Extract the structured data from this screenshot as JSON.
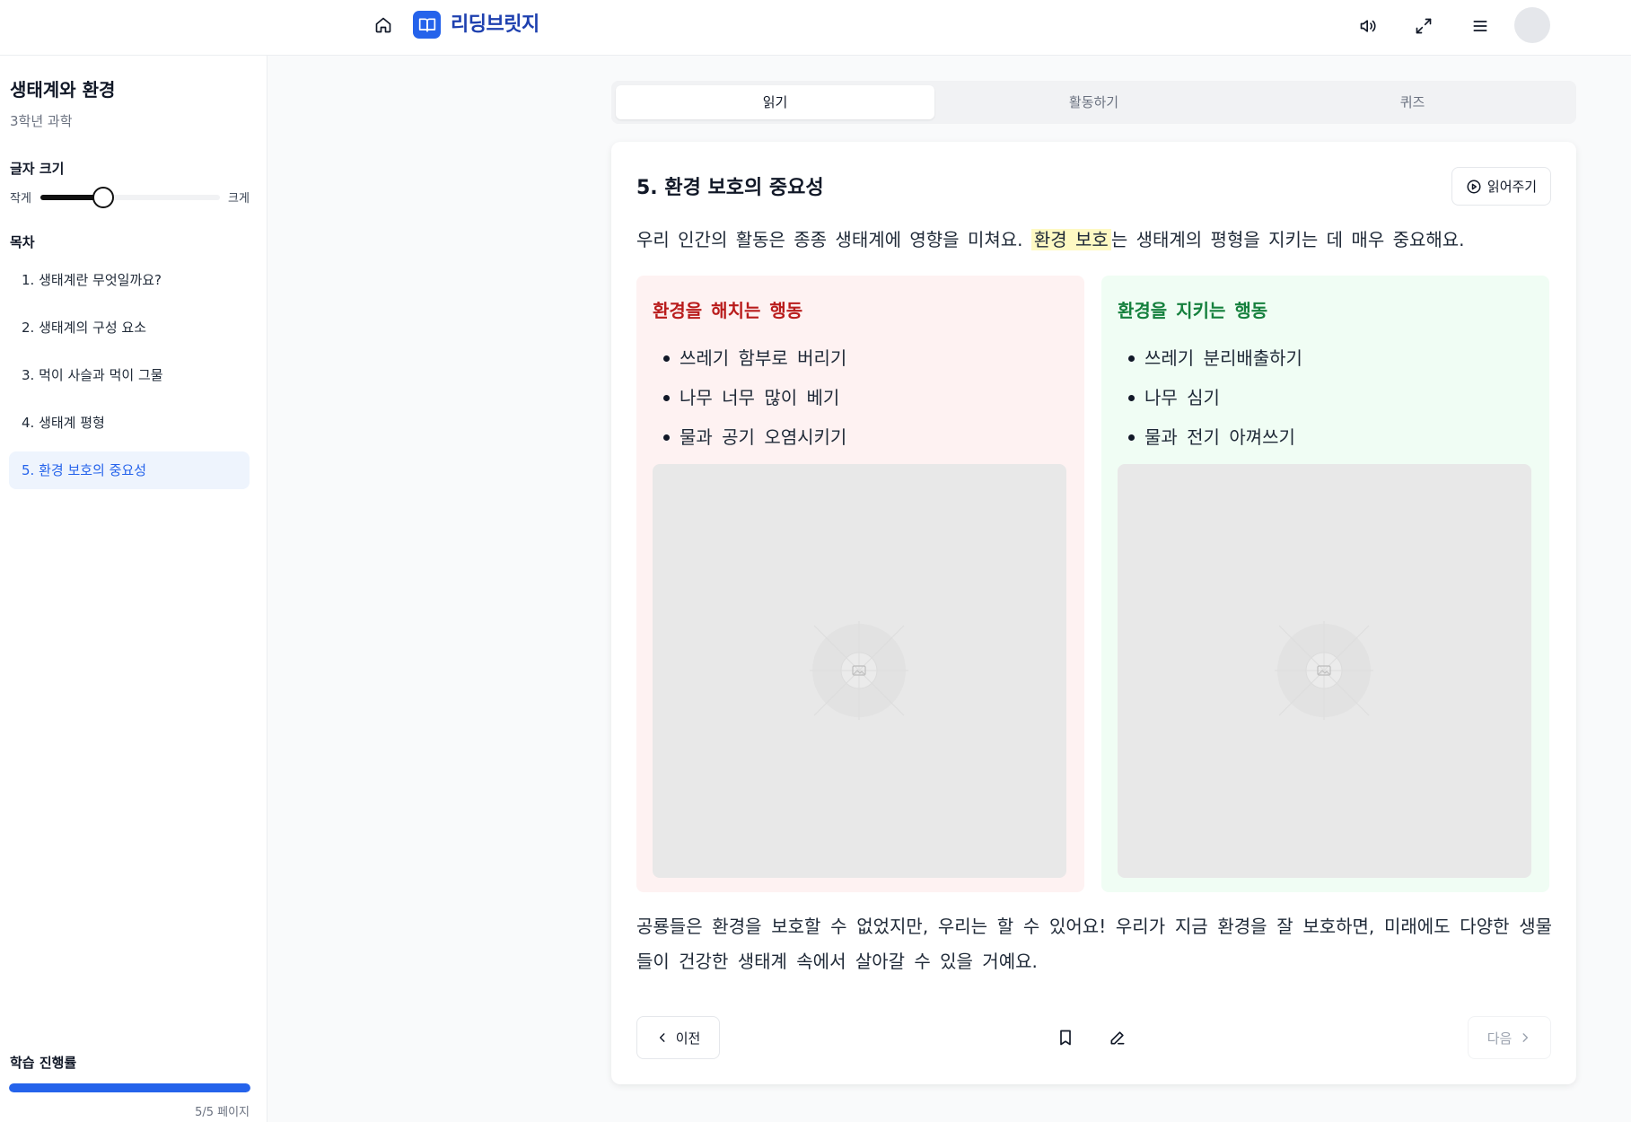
{
  "header": {
    "brand": "리딩브릿지",
    "icons": [
      "home-icon",
      "book-icon",
      "volume-icon",
      "expand-icon",
      "menu-icon",
      "avatar"
    ]
  },
  "sidebar": {
    "title": "생태계와 환경",
    "subtitle": "3학년 과학",
    "font_size": {
      "label": "글자 크기",
      "small_label": "작게",
      "large_label": "크게",
      "level": 0.35
    },
    "toc": {
      "label": "목차",
      "items": [
        {
          "label": "1. 생태계란 무엇일까요?",
          "active": false
        },
        {
          "label": "2. 생태계의 구성 요소",
          "active": false
        },
        {
          "label": "3. 먹이 사슬과 먹이 그물",
          "active": false
        },
        {
          "label": "4. 생태계 평형",
          "active": false
        },
        {
          "label": "5. 환경 보호의 중요성",
          "active": true
        }
      ]
    },
    "progress": {
      "label": "학습 진행률",
      "text": "5/5 페이지",
      "fraction": 1.0
    }
  },
  "tabs": [
    {
      "label": "읽기",
      "active": true
    },
    {
      "label": "활동하기",
      "active": false
    },
    {
      "label": "퀴즈",
      "active": false
    }
  ],
  "content": {
    "title": "5. 환경 보호의 중요성",
    "read_aloud_label": "읽어주기",
    "intro_before": "우리 인간의 활동은 종종 생태계에 영향을 미쳐요. ",
    "intro_highlight": "환경 보호",
    "intro_after": "는 생태계의 평형을 지키는 데 매우 중요해요.",
    "panels": {
      "bad": {
        "title": "환경을 해치는 행동",
        "items": [
          "쓰레기 함부로 버리기",
          "나무 너무 많이 베기",
          "물과 공기 오염시키기"
        ]
      },
      "good": {
        "title": "환경을 지키는 행동",
        "items": [
          "쓰레기 분리배출하기",
          "나무 심기",
          "물과 전기 아껴쓰기"
        ]
      }
    },
    "outro": "공룡들은 환경을 보호할 수 없었지만, 우리는 할 수 있어요! 우리가 지금 환경을 잘 보호하면, 미래에도 다양한 생물들이 건강한 생태계 속에서 살아갈 수 있을 거예요."
  },
  "nav": {
    "prev_label": "이전",
    "next_label": "다음"
  },
  "colors": {
    "accent": "#2563eb",
    "brand_text": "#1e40af",
    "bad_title": "#b91c1c",
    "good_title": "#15803d",
    "bad_bg": "#fef2f2",
    "good_bg": "#f0fdf4",
    "highlight": "#fef9c3"
  }
}
